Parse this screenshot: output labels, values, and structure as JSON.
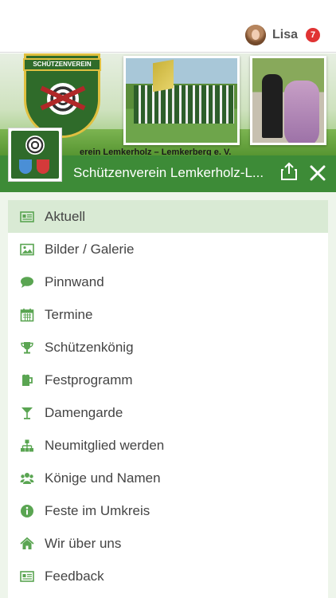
{
  "user": {
    "name": "Lisa",
    "notifications": "7"
  },
  "banner": {
    "crest_top": "SCHÜTZENVEREIN",
    "caption": "erein Lemkerholz – Lemkerberg e. V."
  },
  "header": {
    "title": "Schützenverein Lemkerholz-L..."
  },
  "menu": {
    "items": [
      {
        "label": "Aktuell",
        "icon": "newspaper-icon",
        "active": true
      },
      {
        "label": "Bilder / Galerie",
        "icon": "image-icon"
      },
      {
        "label": "Pinnwand",
        "icon": "comment-icon"
      },
      {
        "label": "Termine",
        "icon": "calendar-icon"
      },
      {
        "label": "Schützenkönig",
        "icon": "trophy-icon"
      },
      {
        "label": "Festprogramm",
        "icon": "beer-mug-icon"
      },
      {
        "label": "Damengarde",
        "icon": "cocktail-glass-icon"
      },
      {
        "label": "Neumitglied werden",
        "icon": "sitemap-icon"
      },
      {
        "label": "Könige und Namen",
        "icon": "users-icon"
      },
      {
        "label": "Feste im Umkreis",
        "icon": "info-icon"
      },
      {
        "label": "Wir über uns",
        "icon": "home-icon"
      },
      {
        "label": "Feedback",
        "icon": "newspaper-icon"
      }
    ]
  },
  "colors": {
    "accent": "#3d8b37",
    "icon": "#5aa552",
    "badge": "#e03333",
    "active_row": "#d9ead4"
  }
}
